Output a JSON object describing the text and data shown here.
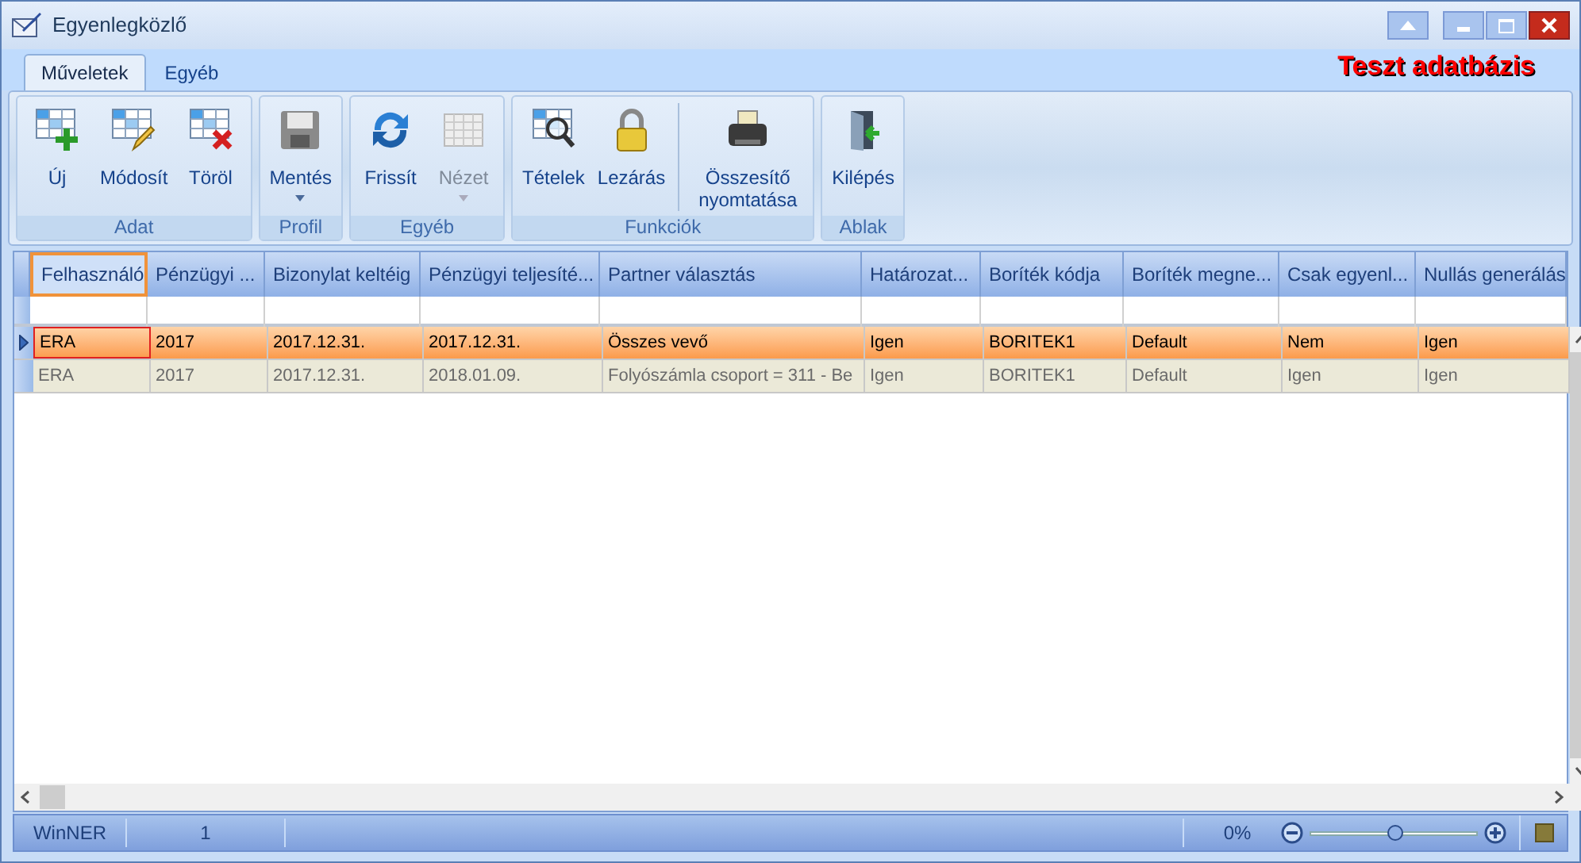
{
  "window": {
    "title": "Egyenlegközlő"
  },
  "tabs": [
    {
      "label": "Műveletek",
      "selected": true
    },
    {
      "label": "Egyéb",
      "selected": false
    }
  ],
  "database_label": "Teszt adatbázis",
  "ribbon_groups": [
    {
      "label": "Adat",
      "buttons": [
        {
          "label": "Új",
          "disabled": false
        },
        {
          "label": "Módosít",
          "disabled": false
        },
        {
          "label": "Töröl",
          "disabled": false
        }
      ]
    },
    {
      "label": "Profil",
      "buttons": [
        {
          "label": "Mentés",
          "disabled": false,
          "dropdown": true
        }
      ]
    },
    {
      "label": "Egyéb",
      "buttons": [
        {
          "label": "Frissít",
          "disabled": false
        },
        {
          "label": "Nézet",
          "disabled": true,
          "dropdown": true
        }
      ]
    },
    {
      "label": "Funkciók",
      "buttons": [
        {
          "label": "Tételek",
          "disabled": false
        },
        {
          "label": "Lezárás",
          "disabled": false
        },
        {
          "label": "Összesítő nyomtatása",
          "disabled": false,
          "separator_before": true
        }
      ]
    },
    {
      "label": "Ablak",
      "buttons": [
        {
          "label": "Kilépés",
          "disabled": false
        }
      ]
    }
  ],
  "table": {
    "columns": [
      {
        "label": "Felhasználó",
        "focused": true
      },
      {
        "label": "Pénzügyi ...",
        "focused": false
      },
      {
        "label": "Bizonylat keltéig",
        "focused": false
      },
      {
        "label": "Pénzügyi teljesíté...",
        "focused": false
      },
      {
        "label": "Partner választás",
        "focused": false
      },
      {
        "label": "Határozat...",
        "focused": false
      },
      {
        "label": "Boríték kódja",
        "focused": false
      },
      {
        "label": "Boríték megne...",
        "focused": false
      },
      {
        "label": "Csak egyenl...",
        "focused": false
      },
      {
        "label": "Nullás generálás",
        "focused": false
      }
    ],
    "rows": [
      {
        "selected": true,
        "disabled": false,
        "cells": [
          "ERA",
          "2017",
          "2017.12.31.",
          "2017.12.31.",
          "Összes vevő",
          "Igen",
          "BORITEK1",
          "Default",
          "Nem",
          "Igen"
        ]
      },
      {
        "selected": false,
        "disabled": true,
        "cells": [
          "ERA",
          "2017",
          "2017.12.31.",
          "2018.01.09.",
          "Folyószámla csoport = 311 - Be",
          "Igen",
          "BORITEK1",
          "Default",
          "Igen",
          "Igen"
        ]
      }
    ]
  },
  "status_bar": {
    "user": "WinNER",
    "count": "1",
    "zoom": "0%",
    "zoom_slider": {
      "level": 0.5
    }
  }
}
